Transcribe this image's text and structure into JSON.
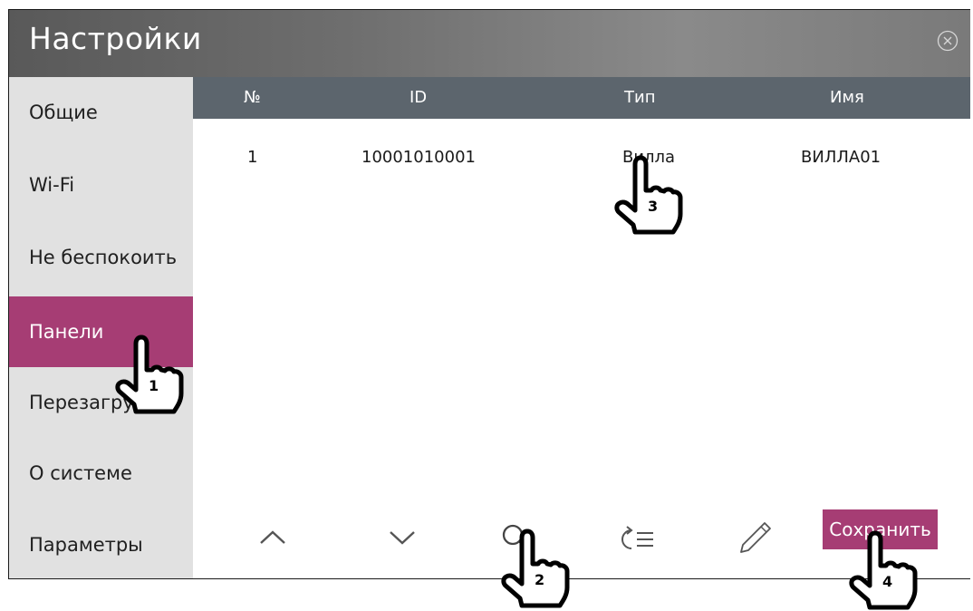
{
  "window": {
    "title": "Настройки"
  },
  "sidebar": {
    "items": [
      {
        "label": "Общие"
      },
      {
        "label": "Wi-Fi"
      },
      {
        "label": "Не беспокоить"
      },
      {
        "label": "Панели"
      },
      {
        "label": "Перезагрузка"
      },
      {
        "label": "О системе"
      },
      {
        "label": "Параметры"
      }
    ],
    "active_index": 3
  },
  "table": {
    "headers": [
      "№",
      "ID",
      "Тип",
      "Имя"
    ],
    "rows": [
      {
        "num": "1",
        "id": "10001010001",
        "type": "Вилла",
        "name": "ВИЛЛА01"
      }
    ]
  },
  "toolbar": {
    "icons": [
      "chevron-up-icon",
      "chevron-down-icon",
      "search-icon",
      "refresh-list-icon",
      "pencil-icon"
    ],
    "save_label": "Сохранить"
  },
  "annotations": [
    "1",
    "2",
    "3",
    "4"
  ],
  "colors": {
    "accent": "#a63d74",
    "header": "#5c656d",
    "sidebar": "#e1e1e1"
  }
}
